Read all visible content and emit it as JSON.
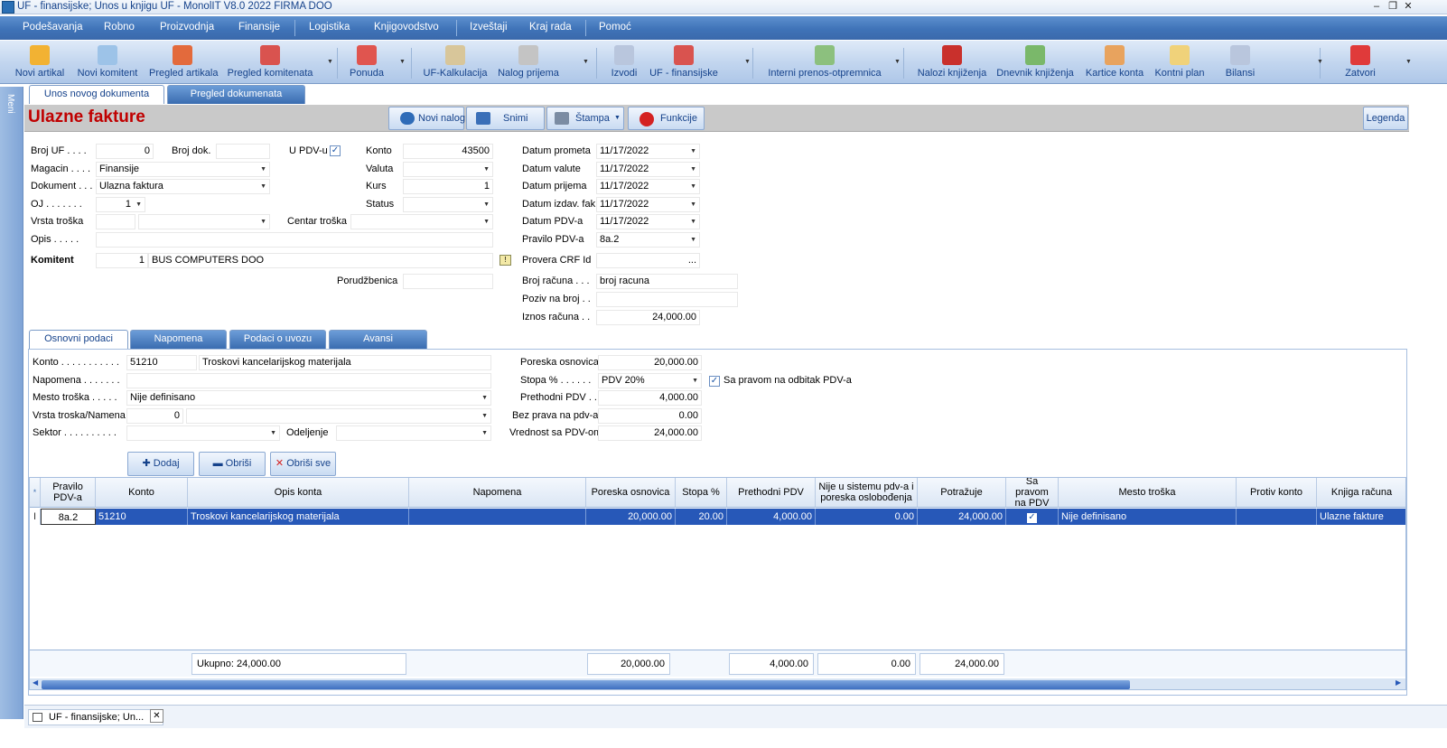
{
  "window": {
    "title": "UF - finansijske; Unos u knjigu UF - MonolIT V8.0 2022 FIRMA DOO"
  },
  "menu": [
    "Podešavanja",
    "Robno",
    "Proizvodnja",
    "Finansije",
    "Logistika",
    "Knjigovodstvo",
    "Izveštaji",
    "Kraj rada",
    "Pomoć"
  ],
  "toolbar": [
    {
      "label": "Novi artikal",
      "icon": "new-item-icon",
      "color": "#f2b233"
    },
    {
      "label": "Novi komitent",
      "icon": "new-partner-icon",
      "color": "#9dc3e8"
    },
    {
      "label": "Pregled artikala",
      "icon": "items-icon",
      "color": "#e36a3c"
    },
    {
      "label": "Pregled komitenata",
      "icon": "partners-icon",
      "color": "#d9534f"
    },
    {
      "label": "Ponuda",
      "icon": "offer-icon",
      "color": "#e0554f"
    },
    {
      "label": "UF-Kalkulacija",
      "icon": "calculation-icon",
      "color": "#d8c69a"
    },
    {
      "label": "Nalog prijema",
      "icon": "receipt-order-icon",
      "color": "#c4c4c4"
    },
    {
      "label": "Izvodi",
      "icon": "statements-icon",
      "color": "#b9c6dd"
    },
    {
      "label": "UF - finansijske",
      "icon": "finance-icon",
      "color": "#d9534f"
    },
    {
      "label": "Interni prenos-otpremnica",
      "icon": "transfer-icon",
      "color": "#8cc07e"
    },
    {
      "label": "Nalozi knjiženja",
      "icon": "posting-orders-icon",
      "color": "#c9302c"
    },
    {
      "label": "Dnevnik knjiženja",
      "icon": "journal-icon",
      "color": "#7ab86a"
    },
    {
      "label": "Kartice konta",
      "icon": "account-cards-icon",
      "color": "#e8a35e"
    },
    {
      "label": "Kontni plan",
      "icon": "chart-of-accounts-icon",
      "color": "#f0d27a"
    },
    {
      "label": "Bilansi",
      "icon": "balance-icon",
      "color": "#b9c6dd"
    },
    {
      "label": "Zatvori",
      "icon": "close-icon",
      "color": "#e03a3a"
    }
  ],
  "sidebar": {
    "label": "Meni"
  },
  "tabs": {
    "entry": "Unos novog dokumenta",
    "review": "Pregled dokumenata"
  },
  "header": {
    "title": "Ulazne fakture",
    "new_label": "Novi nalog",
    "save_label": "Snimi",
    "print_label": "Štampa",
    "functions_label": "Funkcije",
    "legend_label": "Legenda"
  },
  "form": {
    "broj_uf_label": "Broj UF . . . .",
    "broj_uf": "0",
    "broj_dok_label": "Broj dok.",
    "broj_dok": "",
    "u_pdv_label": "U PDV-u",
    "konto_label": "Konto",
    "konto": "43500",
    "magacin_label": "Magacin . . . .",
    "magacin": "Finansije",
    "valuta_label": "Valuta",
    "valuta": "",
    "dokument_label": "Dokument . . .",
    "dokument": "Ulazna faktura",
    "kurs_label": "Kurs",
    "kurs": "1",
    "oj_label": "OJ . . . . . . .",
    "oj": "1",
    "status_label": "Status",
    "status": "",
    "vrsta_troska_label": "Vrsta troška",
    "centar_troska_label": "Centar troška",
    "opis_label": "Opis . . . . .",
    "opis": "",
    "komitent_label": "Komitent",
    "komitent_id": "1",
    "komitent_name": "BUS COMPUTERS DOO",
    "porudzbenica_label": "Porudžbenica",
    "porudzbenica": "",
    "datum_prometa_label": "Datum prometa",
    "datum_prometa": "11/17/2022",
    "datum_valute_label": "Datum valute",
    "datum_valute": "11/17/2022",
    "datum_prijema_label": "Datum prijema",
    "datum_prijema": "11/17/2022",
    "datum_izdav_label": "Datum izdav. fak.",
    "datum_izdav": "11/17/2022",
    "datum_pdv_label": "Datum PDV-a",
    "datum_pdv": "11/17/2022",
    "pravilo_pdv_label": "Pravilo PDV-a",
    "pravilo_pdv": "8a.2",
    "provera_crf_label": "Provera CRF Id",
    "provera_crf_btn": "...",
    "broj_racuna_label": "Broj računa . . .",
    "broj_racuna": "broj racuna",
    "poziv_label": "Poziv na broj . .",
    "poziv": "",
    "iznos_label": "Iznos računa . .",
    "iznos": "24,000.00"
  },
  "subtabs": [
    "Osnovni podaci",
    "Napomena",
    "Podaci o uvozu",
    "Avansi"
  ],
  "detail": {
    "konto_label": "Konto . . . . . . . . . . .",
    "konto": "51210",
    "konto_opis": "Troskovi kancelarijskog materijala",
    "napomena_label": "Napomena . . . . . . .",
    "napomena": "",
    "mesto_label": "Mesto troška . . . . .",
    "mesto": "Nije definisano",
    "vrsta_label": "Vrsta troska/Namena",
    "vrsta_id": "0",
    "vrsta": "",
    "sektor_label": "Sektor . . . . . . . . . .",
    "sektor": "",
    "odeljenje_label": "Odeljenje",
    "odeljenje": "",
    "poreska_label": "Poreska osnovica",
    "poreska": "20,000.00",
    "stopa_label": "Stopa % . . . . . .",
    "stopa": "PDV 20%",
    "sa_pravom_label": "Sa pravom na odbitak PDV-a",
    "prethodni_label": "Prethodni PDV . . .",
    "prethodni": "4,000.00",
    "bez_prava_label": "Bez prava na pdv-a",
    "bez_prava": "0.00",
    "vrednost_label": "Vrednost sa PDV-om",
    "vrednost": "24,000.00",
    "add_label": "Dodaj",
    "delete_label": "Obriši",
    "delete_all_label": "Obriši sve"
  },
  "grid": {
    "columns": [
      "Pravilo PDV-a",
      "Konto",
      "Opis konta",
      "Napomena",
      "Poreska osnovica",
      "Stopa %",
      "Prethodni PDV",
      "Nije u sistemu pdv-a i poreska oslobođenja",
      "Potražuje",
      "Sa pravom na PDV",
      "Mesto troška",
      "Protiv konto",
      "Knjiga računa"
    ],
    "row": [
      "8a.2",
      "51210",
      "Troskovi kancelarijskog materijala",
      "",
      "20,000.00",
      "20.00",
      "4,000.00",
      "0.00",
      "24,000.00",
      "✓",
      "Nije definisano",
      "",
      "Ulazne fakture"
    ],
    "footer": {
      "ukupno": "Ukupno: 24,000.00",
      "poreska": "20,000.00",
      "prethodni": "4,000.00",
      "nije": "0.00",
      "potrazuje": "24,000.00"
    }
  },
  "taskbar": {
    "doc_tab": "UF - finansijske; Un..."
  }
}
